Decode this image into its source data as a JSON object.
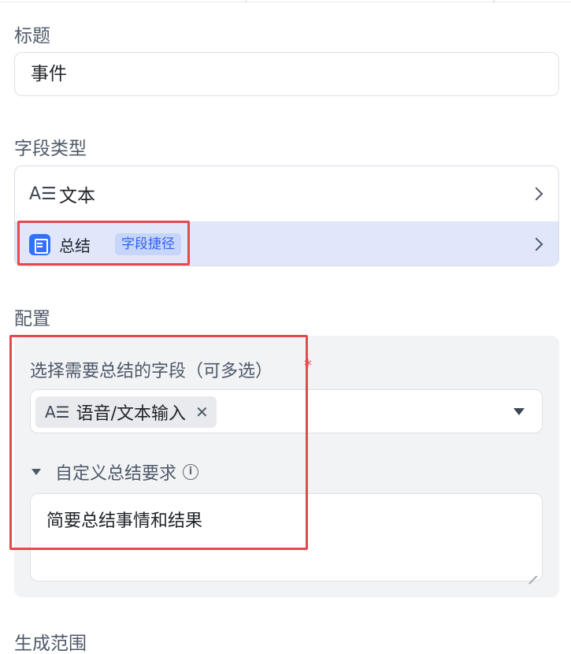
{
  "title_section": {
    "label": "标题",
    "value": "事件"
  },
  "field_type_section": {
    "label": "字段类型",
    "options": [
      {
        "icon": "text-type-icon",
        "icon_glyph": "A☰",
        "label": "文本"
      },
      {
        "icon": "summary-icon",
        "label": "总结",
        "badge": "字段捷径"
      }
    ]
  },
  "config_section": {
    "label": "配置",
    "select_fields": {
      "label": "选择需要总结的字段（可多选）",
      "required_mark": "*",
      "selected_tags": [
        {
          "icon_glyph": "A☰",
          "label": "语音/文本输入",
          "remove": "✕"
        }
      ]
    },
    "custom_requirements": {
      "label": "自定义总结要求",
      "info_glyph": "i",
      "value": "简要总结事情和结果"
    }
  },
  "range_section": {
    "label": "生成范围"
  },
  "colors": {
    "accent": "#3370ff",
    "highlight": "#e5484d",
    "selected_row_bg": "#e1e7fb",
    "panel_bg": "#f2f3f5"
  }
}
